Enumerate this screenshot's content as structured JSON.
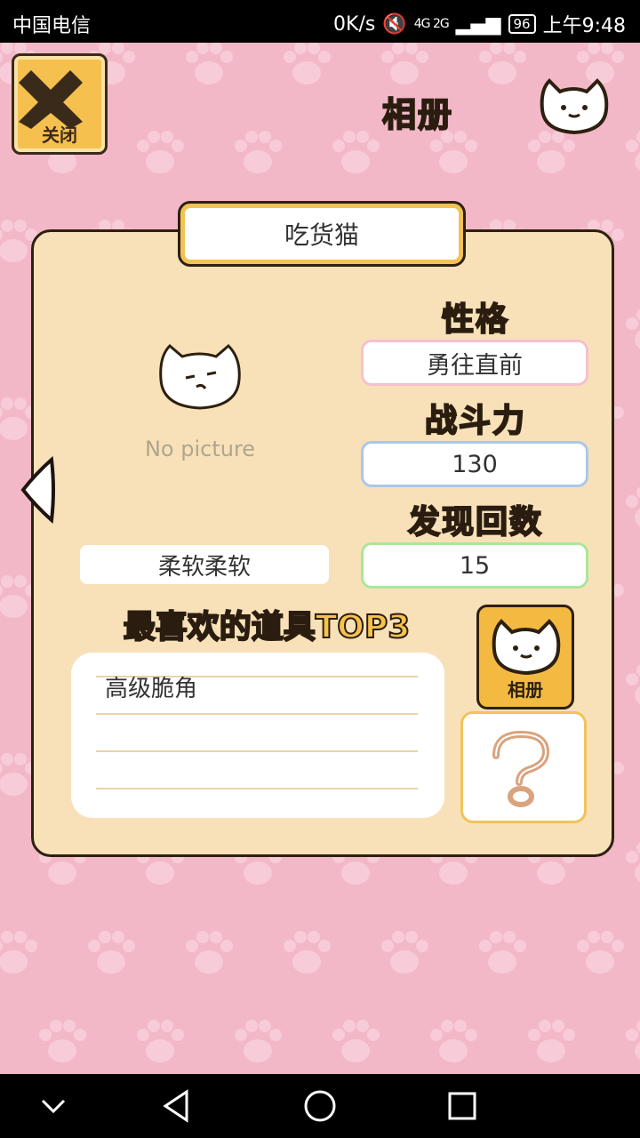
{
  "status_bar": {
    "carrier": "中国电信",
    "speed": "0K/s",
    "network": "4G 2G",
    "battery": "96",
    "time": "上午9:48"
  },
  "header": {
    "close_label": "关闭",
    "title": "相册"
  },
  "cat": {
    "name": "吃货猫",
    "no_picture_text": "No picture",
    "description": "柔软柔软",
    "personality_title": "性格",
    "personality": "勇往直前",
    "power_title": "战斗力",
    "power": "130",
    "found_title": "发现回数",
    "found_count": "15"
  },
  "favorites": {
    "title": "最喜欢的道具TOP3",
    "items": [
      "高级脆角",
      "",
      ""
    ]
  },
  "buttons": {
    "album_label": "相册"
  },
  "colors": {
    "background": "#f3b8c8",
    "panel": "#f8e1b8",
    "accent": "#f3b941"
  }
}
